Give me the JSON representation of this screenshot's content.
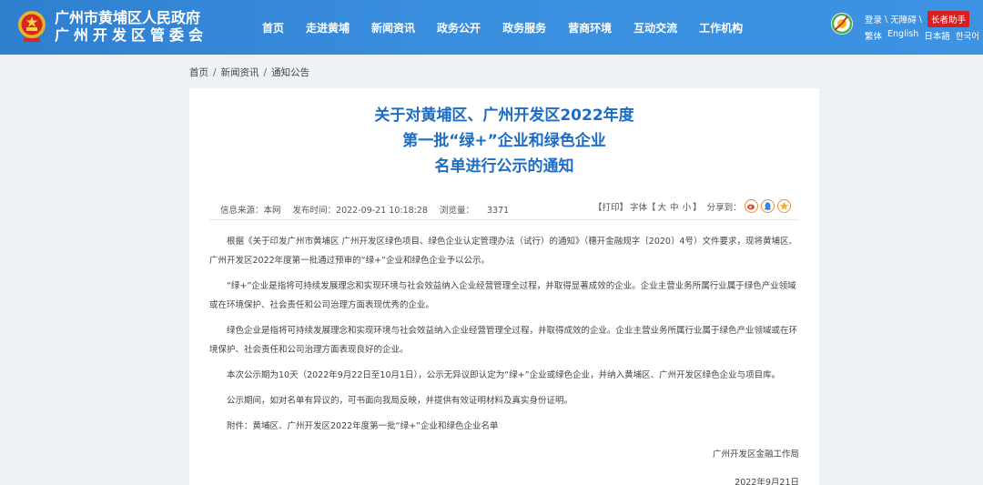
{
  "header": {
    "org_name_1": "广州市黄埔区人民政府",
    "org_name_2": "广州开发区管委会",
    "nav": [
      "首页",
      "走进黄埔",
      "新闻资讯",
      "政务公开",
      "政务服务",
      "营商环境",
      "互动交流",
      "工作机构"
    ],
    "login": "登录",
    "accessibility": "无障碍",
    "elder_mode": "长者助手",
    "separator": "\\",
    "languages": [
      "繁体",
      "English",
      "日本語",
      "한국어"
    ]
  },
  "breadcrumb": [
    "首页",
    "新闻资讯",
    "通知公告"
  ],
  "breadcrumb_sep": "/",
  "article": {
    "title_lines": [
      "关于对黄埔区、广州开发区2022年度",
      "第一批“绿+”企业和绿色企业",
      "名单进行公示的通知"
    ],
    "meta": {
      "source": "信息来源：本网",
      "published": "发布时间：2022-09-21 10:18:28",
      "views_label": "浏览量：",
      "views": "3371"
    },
    "tools": {
      "print": "【打印】",
      "font_label": "字体【",
      "font_large": "大",
      "font_medium": "中",
      "font_small": "小",
      "font_close": "】",
      "share_label": "分享到："
    },
    "paragraphs": [
      "根据《关于印发广州市黄埔区 广州开发区绿色项目、绿色企业认定管理办法（试行）的通知》（穗开金融规字〔2020〕4号）文件要求，现将黄埔区、广州开发区2022年度第一批通过预审的“绿+”企业和绿色企业予以公示。",
      "“绿+”企业是指将可持续发展理念和实现环境与社会效益纳入企业经营管理全过程，并取得显著成效的企业。企业主营业务所属行业属于绿色产业领域或在环境保护、社会责任和公司治理方面表现优秀的企业。",
      "绿色企业是指将可持续发展理念和实现环境与社会效益纳入企业经营管理全过程，并取得成效的企业。企业主营业务所属行业属于绿色产业领域或在环境保护、社会责任和公司治理方面表现良好的企业。",
      "本次公示期为10天（2022年9月22日至10月1日），公示无异议即认定为“绿+”企业或绿色企业，并纳入黄埔区、广州开发区绿色企业与项目库。",
      "公示期间，如对名单有异议的，可书面向我局反映，并提供有效证明材料及真实身份证明。",
      "附件：黄埔区、广州开发区2022年度第一批“绿+”企业和绿色企业名单"
    ],
    "signature": "广州开发区金融工作局",
    "date": "2022年9月21日"
  },
  "colors": {
    "header_blue": "#3a8ede",
    "title_blue": "#1c6cc6",
    "elder_red": "#d81e1e",
    "page_bg": "#eef1f5"
  }
}
